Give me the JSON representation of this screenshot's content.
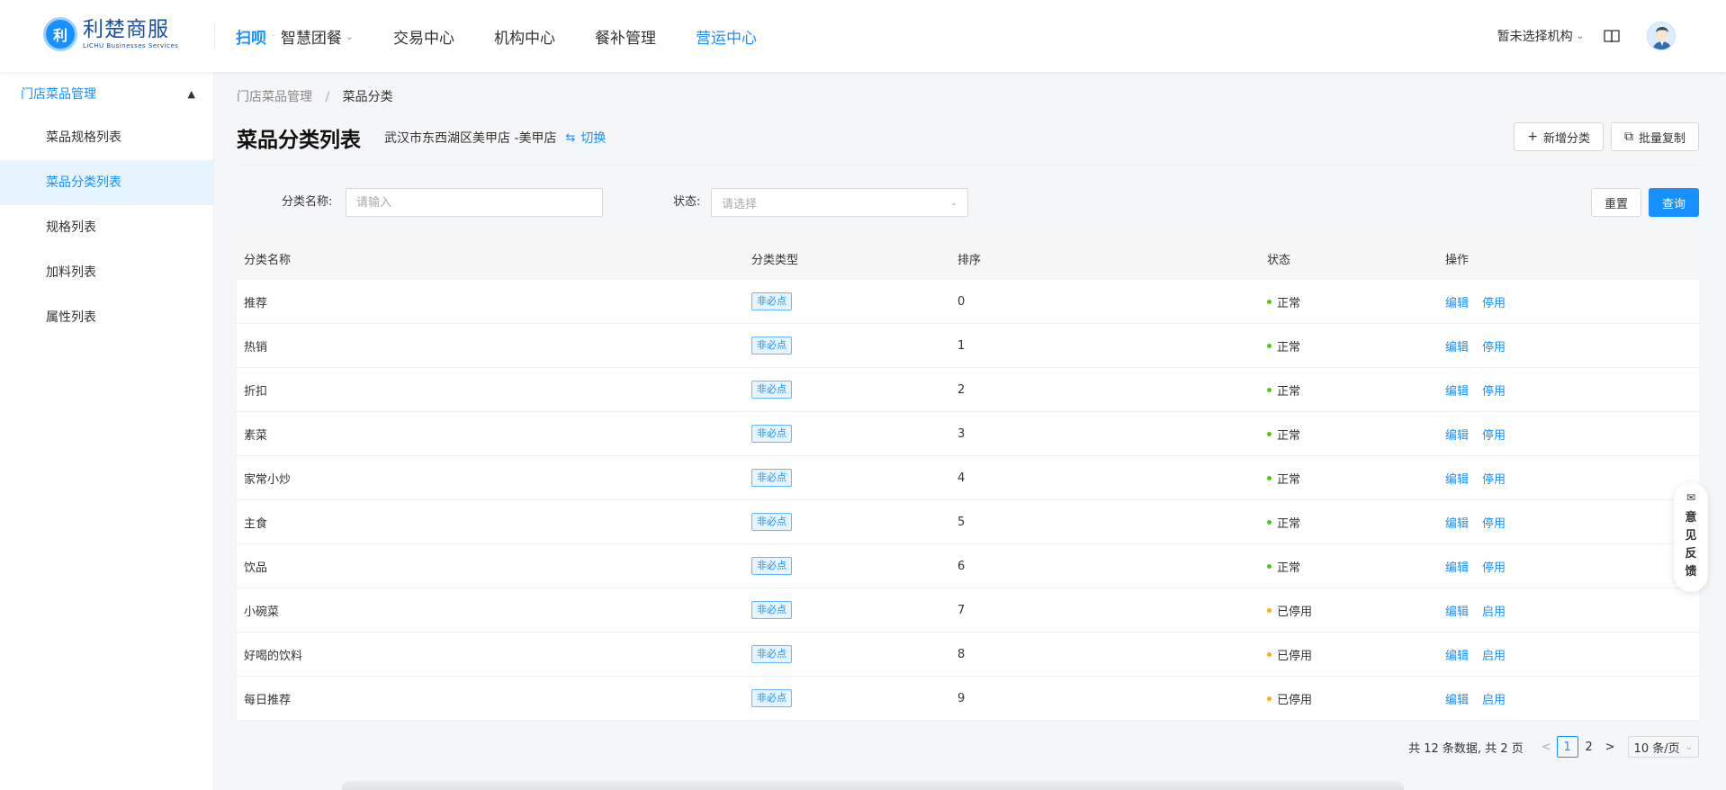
{
  "brand": {
    "name": "利楚商服",
    "subtitle": "LiCHU Businesses Services",
    "mark": "利"
  },
  "nav": {
    "scan": "扫呗",
    "dot": "·",
    "items": [
      {
        "label": "智慧团餐"
      },
      {
        "label": "交易中心"
      },
      {
        "label": "机构中心"
      },
      {
        "label": "餐补管理"
      },
      {
        "label": "营运中心"
      }
    ],
    "active_index": 4
  },
  "header": {
    "org_select": "暂未选择机构"
  },
  "sidebar": {
    "group": "门店菜品管理",
    "items": [
      {
        "label": "菜品规格列表"
      },
      {
        "label": "菜品分类列表"
      },
      {
        "label": "规格列表"
      },
      {
        "label": "加料列表"
      },
      {
        "label": "属性列表"
      }
    ],
    "active_index": 1
  },
  "breadcrumb": {
    "parent": "门店菜品管理",
    "separator": "/",
    "current": "菜品分类"
  },
  "page": {
    "title": "菜品分类列表",
    "store": "武汉市东西湖区美甲店 -美甲店",
    "switch_label": "切换",
    "add_label": "新增分类",
    "batch_copy_label": "批量复制"
  },
  "filters": {
    "name_label": "分类名称:",
    "name_placeholder": "请输入",
    "status_label": "状态:",
    "status_placeholder": "请选择",
    "reset_label": "重置",
    "query_label": "查询"
  },
  "table": {
    "headers": [
      "分类名称",
      "分类类型",
      "排序",
      "状态",
      "操作"
    ],
    "rows": [
      {
        "name": "推荐",
        "type": "非必点",
        "sort": "0",
        "status": "正常",
        "op1": "编辑",
        "op2": "停用"
      },
      {
        "name": "热销",
        "type": "非必点",
        "sort": "1",
        "status": "正常",
        "op1": "编辑",
        "op2": "停用"
      },
      {
        "name": "折扣",
        "type": "非必点",
        "sort": "2",
        "status": "正常",
        "op1": "编辑",
        "op2": "停用"
      },
      {
        "name": "素菜",
        "type": "非必点",
        "sort": "3",
        "status": "正常",
        "op1": "编辑",
        "op2": "停用"
      },
      {
        "name": "家常小炒",
        "type": "非必点",
        "sort": "4",
        "status": "正常",
        "op1": "编辑",
        "op2": "停用"
      },
      {
        "name": "主食",
        "type": "非必点",
        "sort": "5",
        "status": "正常",
        "op1": "编辑",
        "op2": "停用"
      },
      {
        "name": "饮品",
        "type": "非必点",
        "sort": "6",
        "status": "正常",
        "op1": "编辑",
        "op2": "停用"
      },
      {
        "name": "小碗菜",
        "type": "非必点",
        "sort": "7",
        "status": "已停用",
        "op1": "编辑",
        "op2": "启用"
      },
      {
        "name": "好喝的饮料",
        "type": "非必点",
        "sort": "8",
        "status": "已停用",
        "op1": "编辑",
        "op2": "启用"
      },
      {
        "name": "每日推荐",
        "type": "非必点",
        "sort": "9",
        "status": "已停用",
        "op1": "编辑",
        "op2": "启用"
      }
    ]
  },
  "status_colors": {
    "正常": "#52c41a",
    "已停用": "#faad14"
  },
  "pagination": {
    "total": "共 12 条数据, 共 2 页",
    "pages": [
      "1",
      "2"
    ],
    "current": "1",
    "page_size": "10 条/页"
  },
  "feedback": {
    "label": [
      "意",
      "见",
      "反",
      "馈"
    ]
  },
  "colors": {
    "accent": "#1890ff"
  }
}
